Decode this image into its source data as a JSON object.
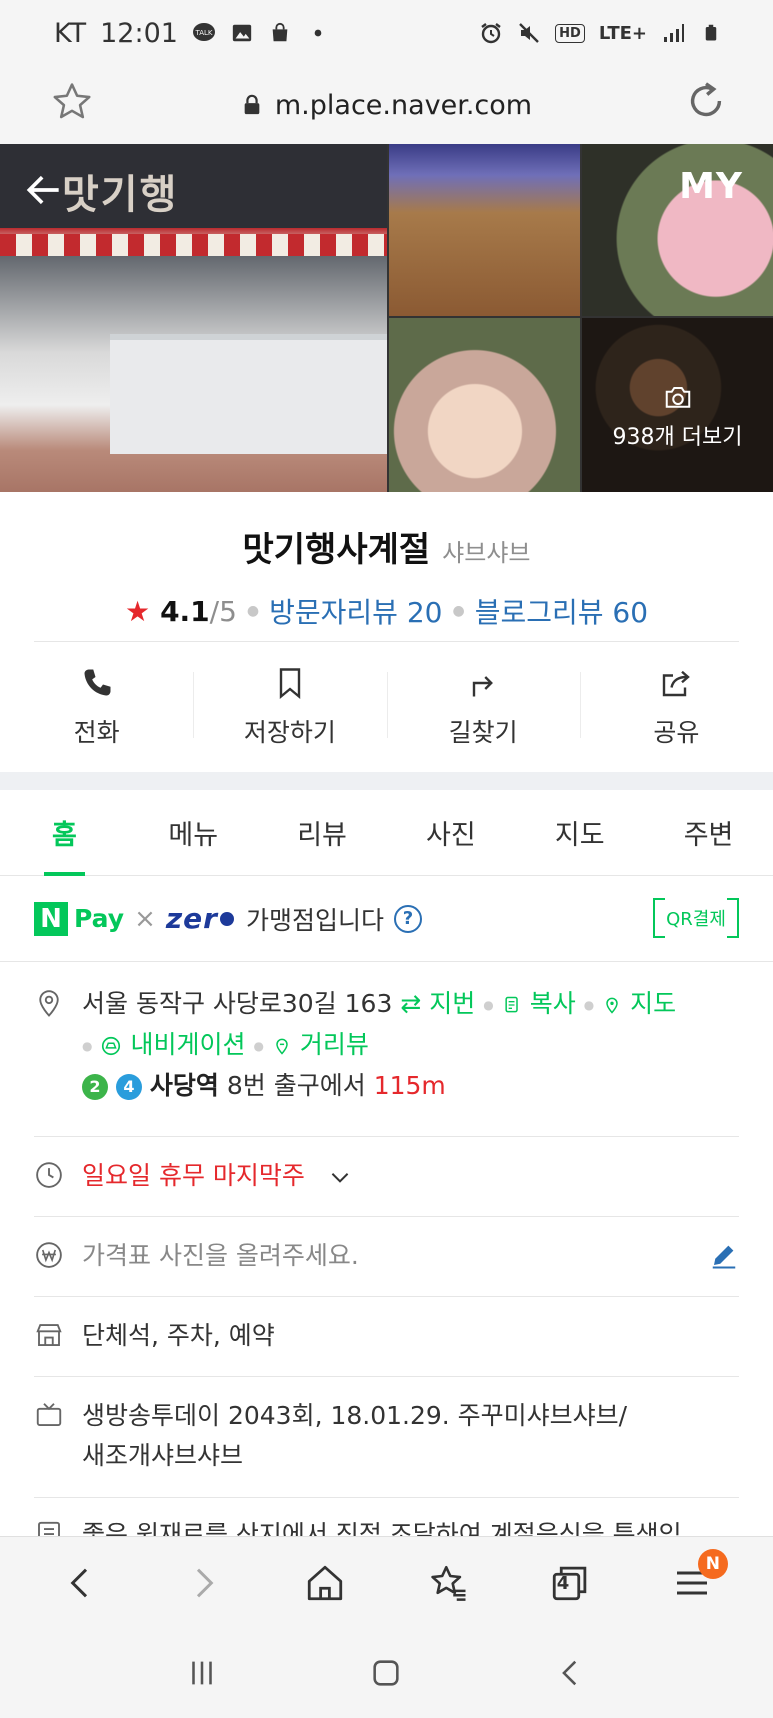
{
  "status_bar": {
    "carrier": "KT",
    "time": "12:01",
    "network": "LTE+",
    "hd_label": "HD",
    "talk_label": "TALK"
  },
  "browser": {
    "url": "m.place.naver.com",
    "open_tabs": "4",
    "menu_badge": "N"
  },
  "photos": {
    "sign_text": "맛기행",
    "my_label": "MY",
    "more_photos_label": "938개 더보기"
  },
  "place": {
    "name": "맛기행사계절",
    "category": "샤브샤브",
    "rating": "4.1",
    "rating_max": "/5",
    "visitor_review_label": "방문자리뷰 20",
    "blog_review_label": "블로그리뷰 60"
  },
  "actions": [
    {
      "label": "전화"
    },
    {
      "label": "저장하기"
    },
    {
      "label": "길찾기"
    },
    {
      "label": "공유"
    }
  ],
  "tabs": [
    {
      "label": "홈"
    },
    {
      "label": "메뉴"
    },
    {
      "label": "리뷰"
    },
    {
      "label": "사진"
    },
    {
      "label": "지도"
    },
    {
      "label": "주변"
    }
  ],
  "pay": {
    "n_label": "N",
    "npay_label": "Pay",
    "x_label": "×",
    "zero_label": "zer",
    "merchant_text": "가맹점입니다",
    "help_label": "?",
    "qr_label": "QR결제"
  },
  "address": {
    "text": "서울 동작구 사당로30길 163",
    "jibun_link": "지번",
    "copy_link": "복사",
    "map_link": "지도",
    "navigation_link": "내비게이션",
    "streetview_link": "거리뷰",
    "line_badges": [
      "2",
      "4"
    ],
    "station": "사당역",
    "exit_text": "8번 출구에서",
    "distance": "115m"
  },
  "hours": {
    "text": "일요일 휴무 마지막주"
  },
  "price": {
    "placeholder": "가격표 사진을 올려주세요."
  },
  "amenities": {
    "text": "단체석, 주차, 예약"
  },
  "tv": {
    "line1": "생방송투데이 2043회, 18.01.29. 주꾸미샤브샤브/",
    "line2": "새조개샤브샤브"
  },
  "description": {
    "text": "좋은 원재료를 산지에서 직접 조달하여 계절음식을 특색있"
  },
  "colors": {
    "naver_green": "#03c75a",
    "link_blue": "#2a6fb4",
    "alert_red": "#e5282c",
    "line2_green": "#3cb44a",
    "line4_blue": "#2a9ddc",
    "zero_navy": "#1d3a9a",
    "badge_orange": "#f56a1e"
  }
}
